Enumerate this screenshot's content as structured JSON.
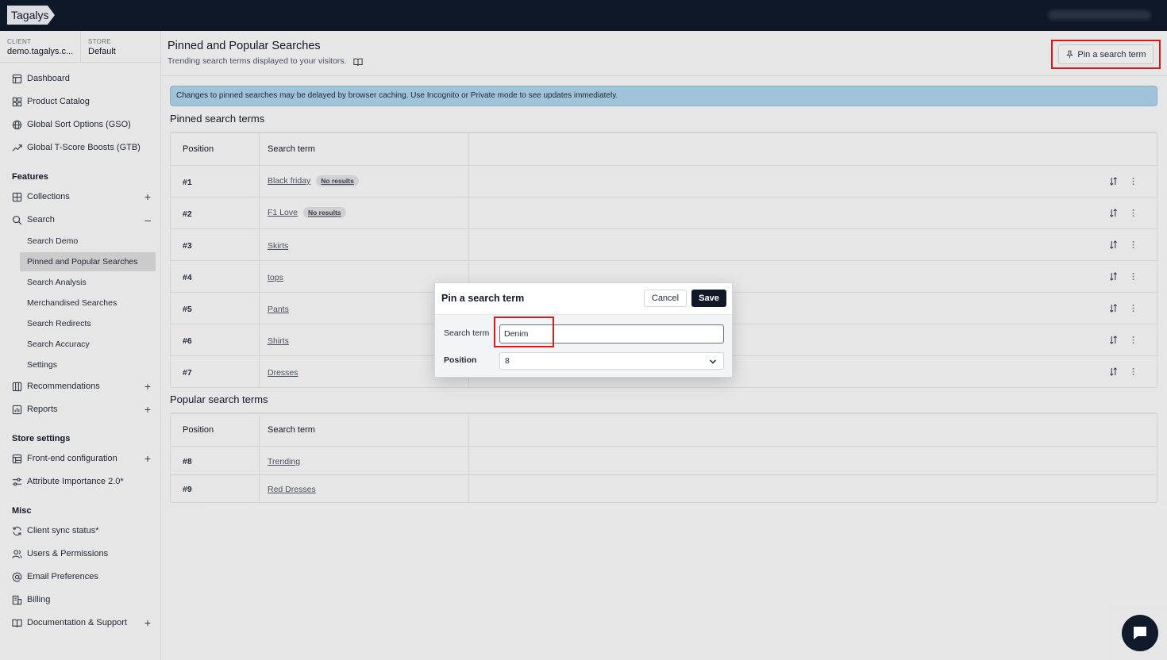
{
  "app": {
    "logo": "Tagalys"
  },
  "context": {
    "client_label": "CLIENT",
    "client_value": "demo.tagalys.c...",
    "store_label": "STORE",
    "store_value": "Default"
  },
  "sidebar": {
    "top_items": [
      "Dashboard",
      "Product Catalog",
      "Global Sort Options (GSO)",
      "Global T-Score Boosts (GTB)"
    ],
    "features_heading": "Features",
    "features": [
      "Collections",
      "Search",
      "Recommendations",
      "Reports"
    ],
    "search_sub": [
      "Search Demo",
      "Pinned and Popular Searches",
      "Search Analysis",
      "Merchandised Searches",
      "Search Redirects",
      "Search Accuracy",
      "Settings"
    ],
    "store_heading": "Store settings",
    "store_items": [
      "Front-end configuration",
      "Attribute Importance 2.0*"
    ],
    "misc_heading": "Misc",
    "misc_items": [
      "Client sync status*",
      "Users & Permissions",
      "Email Preferences",
      "Billing",
      "Documentation & Support"
    ],
    "plus": "+",
    "minus": "–"
  },
  "page": {
    "title": "Pinned and Popular Searches",
    "subtitle": "Trending search terms displayed to your visitors.",
    "pin_button": "Pin a search term",
    "banner": "Changes to pinned searches may be delayed by browser caching. Use Incognito or Private mode to see updates immediately."
  },
  "pinned": {
    "title": "Pinned search terms",
    "col_position": "Position",
    "col_term": "Search term",
    "rows": [
      {
        "pos": "#1",
        "term": "Black friday",
        "badge": "No results"
      },
      {
        "pos": "#2",
        "term": "F1 Love",
        "badge": "No results"
      },
      {
        "pos": "#3",
        "term": "Skirts"
      },
      {
        "pos": "#4",
        "term": "tops"
      },
      {
        "pos": "#5",
        "term": "Pants"
      },
      {
        "pos": "#6",
        "term": "Shirts"
      },
      {
        "pos": "#7",
        "term": "Dresses"
      }
    ]
  },
  "popular": {
    "title": "Popular search terms",
    "col_position": "Position",
    "col_term": "Search term",
    "rows": [
      {
        "pos": "#8",
        "term": "Trending"
      },
      {
        "pos": "#9",
        "term": "Red Dresses"
      }
    ]
  },
  "modal": {
    "title": "Pin a search term",
    "cancel": "Cancel",
    "save": "Save",
    "term_label": "Search term",
    "term_value": "Denim",
    "position_label": "Position",
    "position_value": "8"
  },
  "colors": {
    "topbar": "#0f1a2b",
    "highlight": "#e01b1b",
    "banner": "#a7cbe3",
    "save_btn": "#111827"
  }
}
